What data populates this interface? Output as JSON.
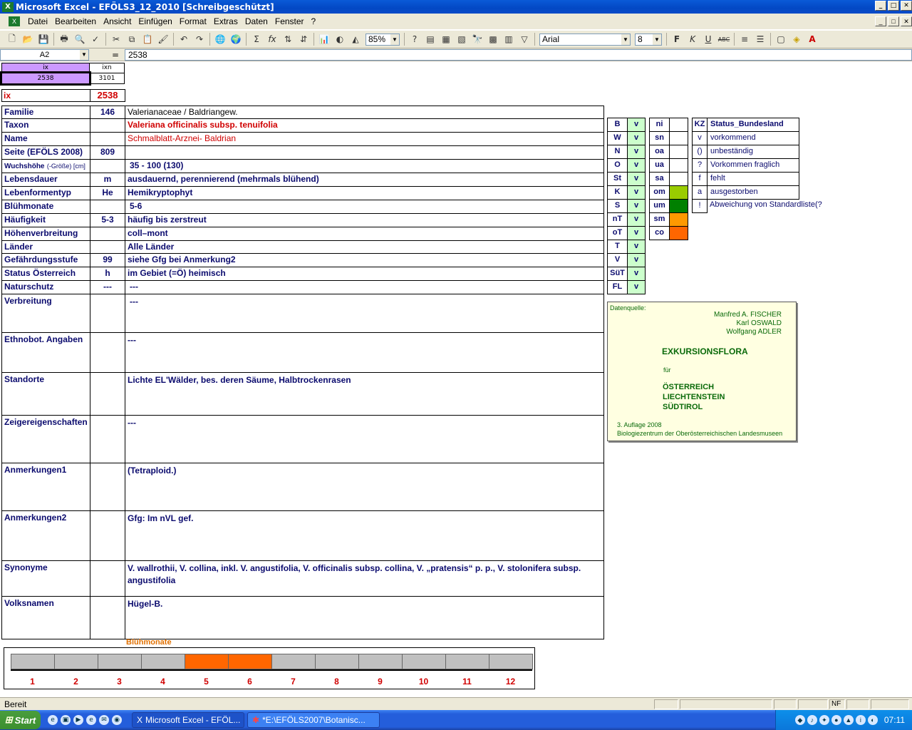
{
  "window": {
    "title": "Microsoft Excel - EFÖLS3_12_2010  [Schreibgeschützt]",
    "min": "_",
    "max": "□",
    "close": "✕"
  },
  "menu": [
    "Datei",
    "Bearbeiten",
    "Ansicht",
    "Einfügen",
    "Format",
    "Extras",
    "Daten",
    "Fenster",
    "?"
  ],
  "toolbar": {
    "zoom": "85%",
    "font": "Arial",
    "size": "8"
  },
  "formula": {
    "cell": "A2",
    "eq": "=",
    "value": "2538"
  },
  "ixtable": {
    "h1": "ix",
    "h2": "ixn",
    "v1": "2538",
    "v2": "3101"
  },
  "ixrow": {
    "label": "ix",
    "value": "2538"
  },
  "rows": [
    {
      "label": "Familie",
      "code": "146",
      "value": "Valerianaceae / Baldriangew."
    },
    {
      "label": "Taxon",
      "code": "",
      "value": "Valeriana officinalis subsp. tenuifolia"
    },
    {
      "label": "Name",
      "code": "",
      "value": "Schmalblatt-Arznei- Baldrian"
    },
    {
      "label": "Seite (EFÖLS 2008)",
      "code": "809",
      "value": ""
    },
    {
      "label": "Wuchshöhe",
      "label2": "(-Größe) [cm]",
      "code": "",
      "value": "35 - 100 (130)"
    },
    {
      "label": "Lebensdauer",
      "code": "m",
      "value": "ausdauernd, perennierend (mehrmals blühend)"
    },
    {
      "label": "Lebenformentyp",
      "code": "He",
      "value": "Hemikryptophyt"
    },
    {
      "label": "Blühmonate",
      "code": "",
      "value": "5-6"
    },
    {
      "label": "Häufigkeit",
      "code": "5-3",
      "value": "häufig bis zerstreut"
    },
    {
      "label": "Höhenverbreitung",
      "code": "",
      "value": "coll–mont"
    },
    {
      "label": "Länder",
      "code": "",
      "value": "Alle Länder"
    },
    {
      "label": "Gefährdungsstufe",
      "code": "99",
      "value": "siehe Gfg bei Anmerkung2"
    },
    {
      "label": "Status Österreich",
      "code": "h",
      "value": "im Gebiet (=Ö) heimisch"
    },
    {
      "label": "Naturschutz",
      "code": "---",
      "value": "---"
    },
    {
      "label": "Verbreitung",
      "code": "",
      "value": "---"
    },
    {
      "label": "Ethnobot. Angaben",
      "code": "",
      "value": "---"
    },
    {
      "label": "Standorte",
      "code": "",
      "value": "Lichte EL'Wälder, bes. deren Säume, Halbtrockenrasen"
    },
    {
      "label": "Zeigereigenschaften",
      "code": "",
      "value": "---"
    },
    {
      "label": "Anmerkungen1",
      "code": "",
      "value": "(Tetraploid.)"
    },
    {
      "label": "Anmerkungen2",
      "code": "",
      "value": "Gfg: Im nVL gef."
    },
    {
      "label": "Synonyme",
      "code": "",
      "value": "V. wallrothii, V. collina, inkl. V. angustifolia, V. officinalis subsp. collina, V. „pratensis“ p. p., V. stolonifera subsp. angustifolia"
    },
    {
      "label": "Volksnamen",
      "code": "",
      "value": "Hügel-B."
    }
  ],
  "bundes": [
    {
      "k": "B",
      "v": "v"
    },
    {
      "k": "W",
      "v": "v"
    },
    {
      "k": "N",
      "v": "v"
    },
    {
      "k": "O",
      "v": "v"
    },
    {
      "k": "St",
      "v": "v"
    },
    {
      "k": "K",
      "v": "v"
    },
    {
      "k": "S",
      "v": "v"
    },
    {
      "k": "nT",
      "v": "v"
    },
    {
      "k": "oT",
      "v": "v"
    },
    {
      "k": "T",
      "v": "v"
    },
    {
      "k": "V",
      "v": "v"
    },
    {
      "k": "SüT",
      "v": "v"
    },
    {
      "k": "FL",
      "v": "v"
    }
  ],
  "zones": [
    {
      "k": "ni",
      "color": ""
    },
    {
      "k": "sn",
      "color": ""
    },
    {
      "k": "oa",
      "color": ""
    },
    {
      "k": "ua",
      "color": ""
    },
    {
      "k": "sa",
      "color": ""
    },
    {
      "k": "om",
      "color": "#99cc00"
    },
    {
      "k": "um",
      "color": "#008000"
    },
    {
      "k": "sm",
      "color": "#ff9900"
    },
    {
      "k": "co",
      "color": "#ff6600"
    }
  ],
  "legend": {
    "h1": "KZ",
    "h2": "Status_Bundesland",
    "items": [
      {
        "k": "v",
        "t": "vorkommend"
      },
      {
        "k": "()",
        "t": "unbeständig"
      },
      {
        "k": "?",
        "t": "Vorkommen fraglich"
      },
      {
        "k": "f",
        "t": "fehlt"
      },
      {
        "k": "a",
        "t": "ausgestorben"
      },
      {
        "k": "!",
        "t": "Abweichung von Standardliste(?)"
      }
    ]
  },
  "source": {
    "label": "Datenquelle:",
    "authors": [
      "Manfred A. FISCHER",
      "Karl OSWALD",
      "Wolfgang ADLER"
    ],
    "title": "EXKURSIONSFLORA",
    "fuer": "für",
    "countries": [
      "ÖSTERREICH",
      "LIECHTENSTEIN",
      "SÜDTIROL"
    ],
    "edition": "3. Auflage 2008",
    "publisher": "Biologiezentrum der Oberösterreichischen Landesmuseen"
  },
  "bloom": {
    "title": "Blühmonate",
    "months": [
      "1",
      "2",
      "3",
      "4",
      "5",
      "6",
      "7",
      "8",
      "9",
      "10",
      "11",
      "12"
    ],
    "active": [
      5,
      6
    ],
    "active_color": "#ff6600",
    "inactive_color": "#c0c0c0"
  },
  "status": {
    "text": "Bereit",
    "nf": "NF"
  },
  "taskbar": {
    "start": "Start",
    "tasks": [
      "Microsoft Excel - EFÖL...",
      "*E:\\EFÖLS2007\\Botanisc..."
    ],
    "clock": "07:11"
  }
}
